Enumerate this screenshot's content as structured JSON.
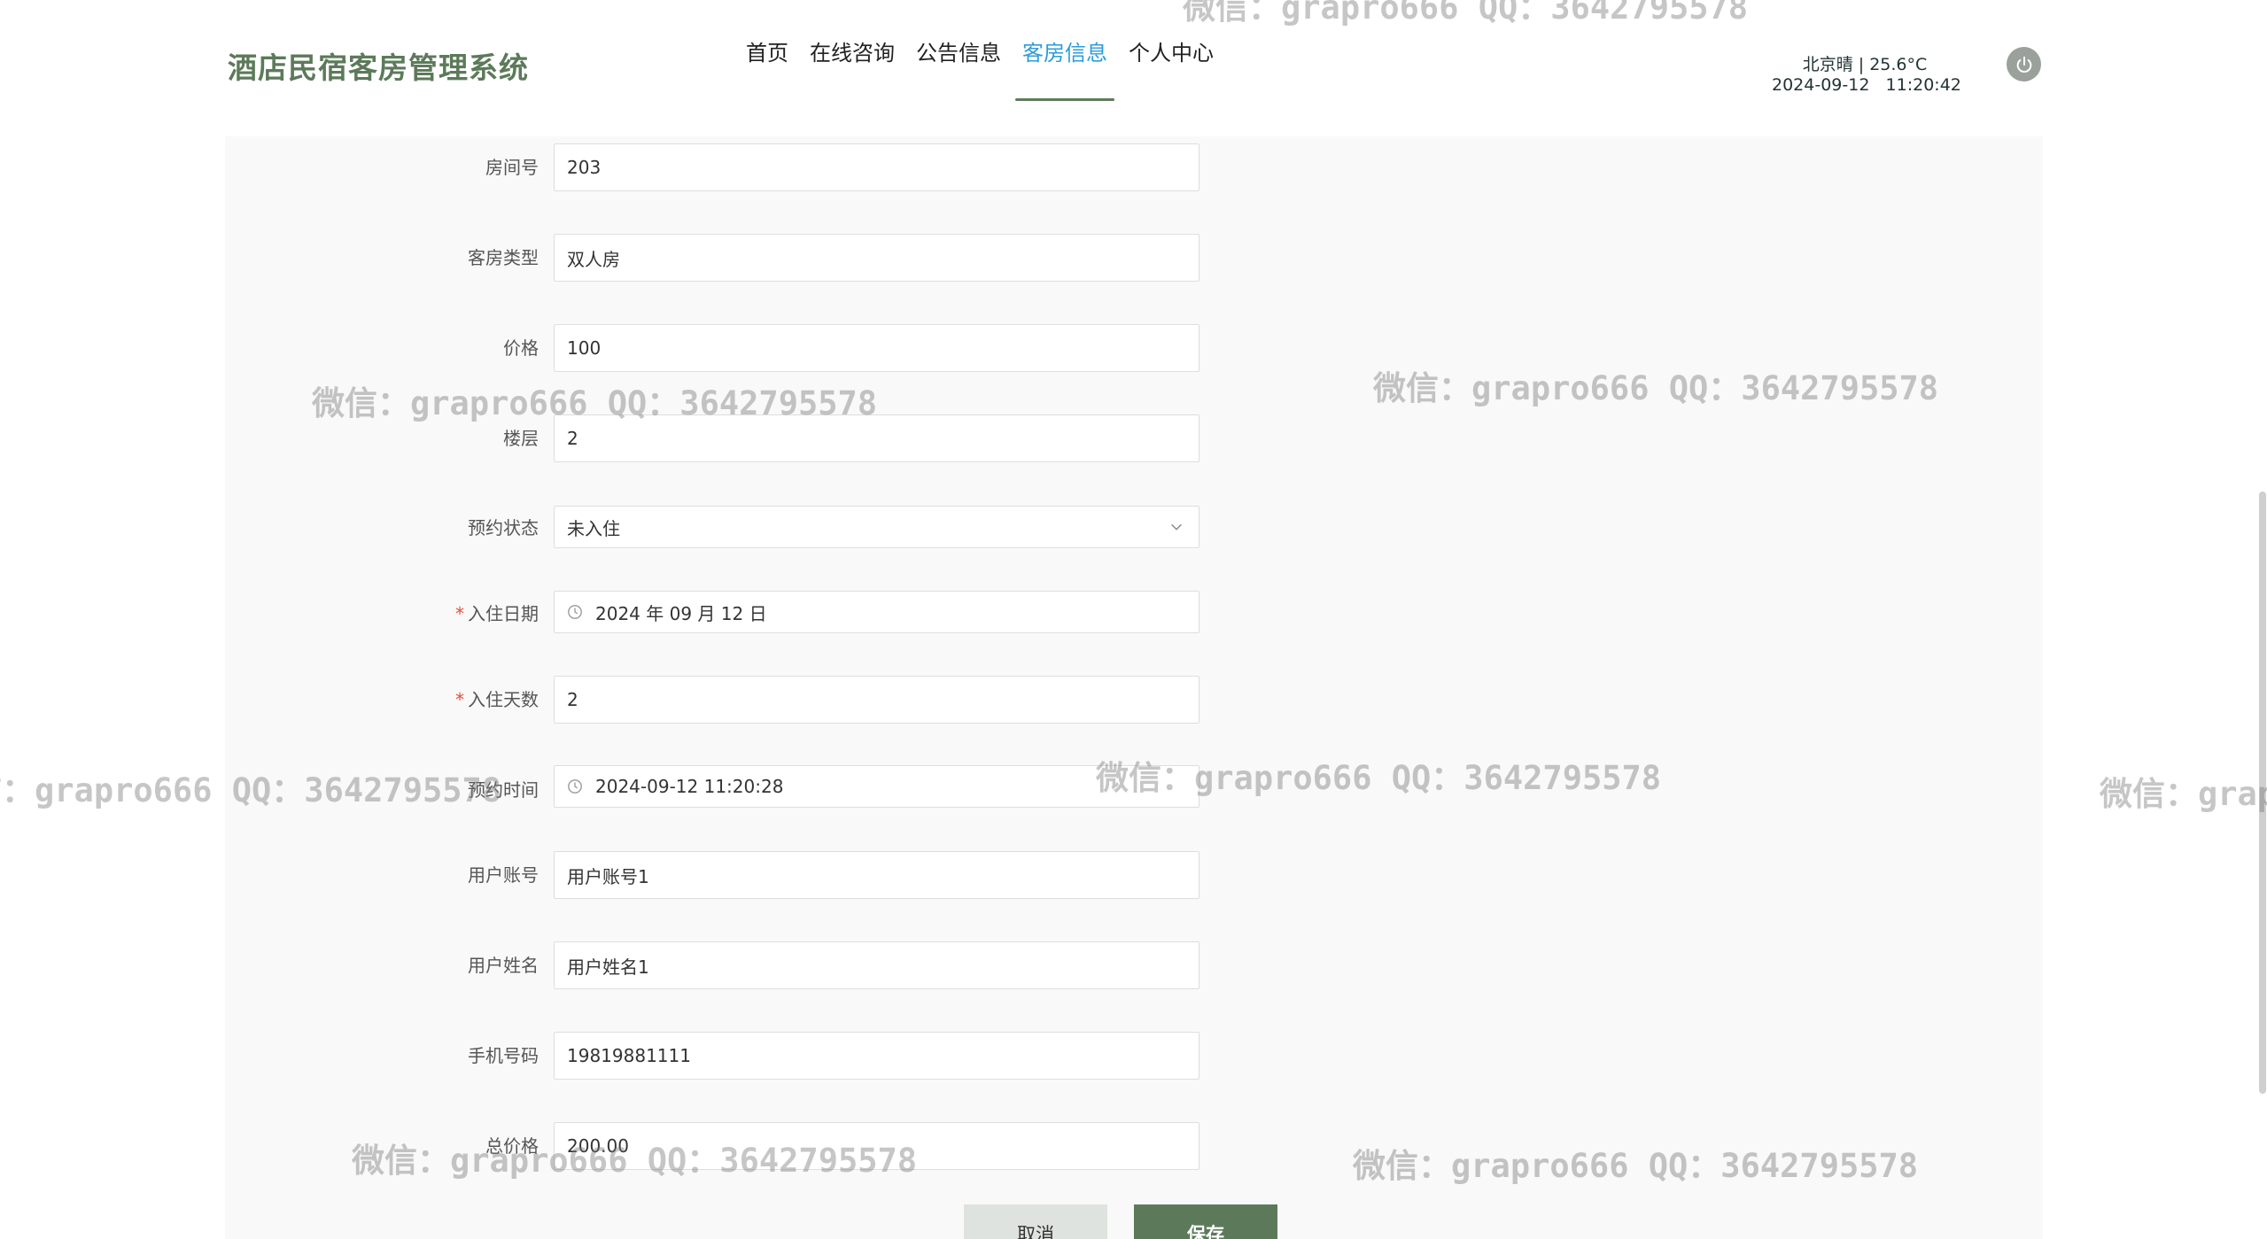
{
  "header": {
    "logo": "酒店民宿客房管理系统",
    "nav": [
      "首页",
      "在线咨询",
      "公告信息",
      "客房信息",
      "个人中心"
    ],
    "active_nav_index": 3,
    "weather": "北京晴 | 25.6°C",
    "datetime": "2024-09-12   11:20:42",
    "power_icon": "power-icon"
  },
  "form": {
    "room_no": {
      "label": "房间号",
      "value": "203"
    },
    "room_type": {
      "label": "客房类型",
      "value": "双人房"
    },
    "price": {
      "label": "价格",
      "value": "100"
    },
    "floor": {
      "label": "楼层",
      "value": "2"
    },
    "status": {
      "label": "预约状态",
      "value": "未入住"
    },
    "checkin_date": {
      "label": "入住日期",
      "value": "2024 年 09 月 12 日",
      "required": true
    },
    "days": {
      "label": "入住天数",
      "value": "2",
      "required": true
    },
    "booking_time": {
      "label": "预约时间",
      "value": "2024-09-12 11:20:28"
    },
    "user_account": {
      "label": "用户账号",
      "value": "用户账号1"
    },
    "user_name": {
      "label": "用户姓名",
      "value": "用户姓名1"
    },
    "phone": {
      "label": "手机号码",
      "value": "19819881111"
    },
    "total_price": {
      "label": "总价格",
      "value": "200.00"
    }
  },
  "buttons": {
    "cancel": "取消",
    "save": "保存"
  },
  "required_mark": "*",
  "watermark": "微信：grapro666 QQ：3642795578",
  "colors": {
    "brand": "#5c7a5a",
    "active_nav": "#2d9cdb",
    "required": "#e74c3c"
  }
}
